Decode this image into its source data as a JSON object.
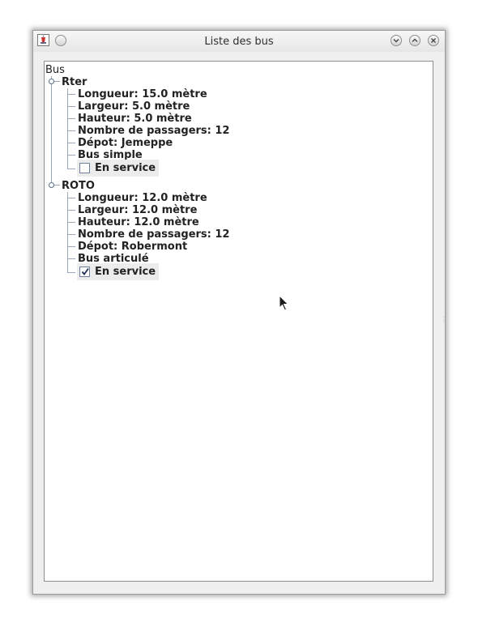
{
  "window": {
    "title": "Liste des bus"
  },
  "tree": {
    "root": "Bus",
    "buses": [
      {
        "name": "Rter",
        "details": [
          "Longueur: 15.0 mètre",
          "Largeur: 5.0 mètre",
          "Hauteur: 5.0 mètre",
          "Nombre de passagers: 12",
          "Dépot: Jemeppe",
          "Bus simple"
        ],
        "service_label": "En service",
        "in_service": false
      },
      {
        "name": "ROTO",
        "details": [
          "Longueur: 12.0 mètre",
          "Largeur: 12.0 mètre",
          "Hauteur: 12.0 mètre",
          "Nombre de passagers: 12",
          "Dépot: Robermont",
          "Bus articulé"
        ],
        "service_label": "En service",
        "in_service": true
      }
    ]
  }
}
